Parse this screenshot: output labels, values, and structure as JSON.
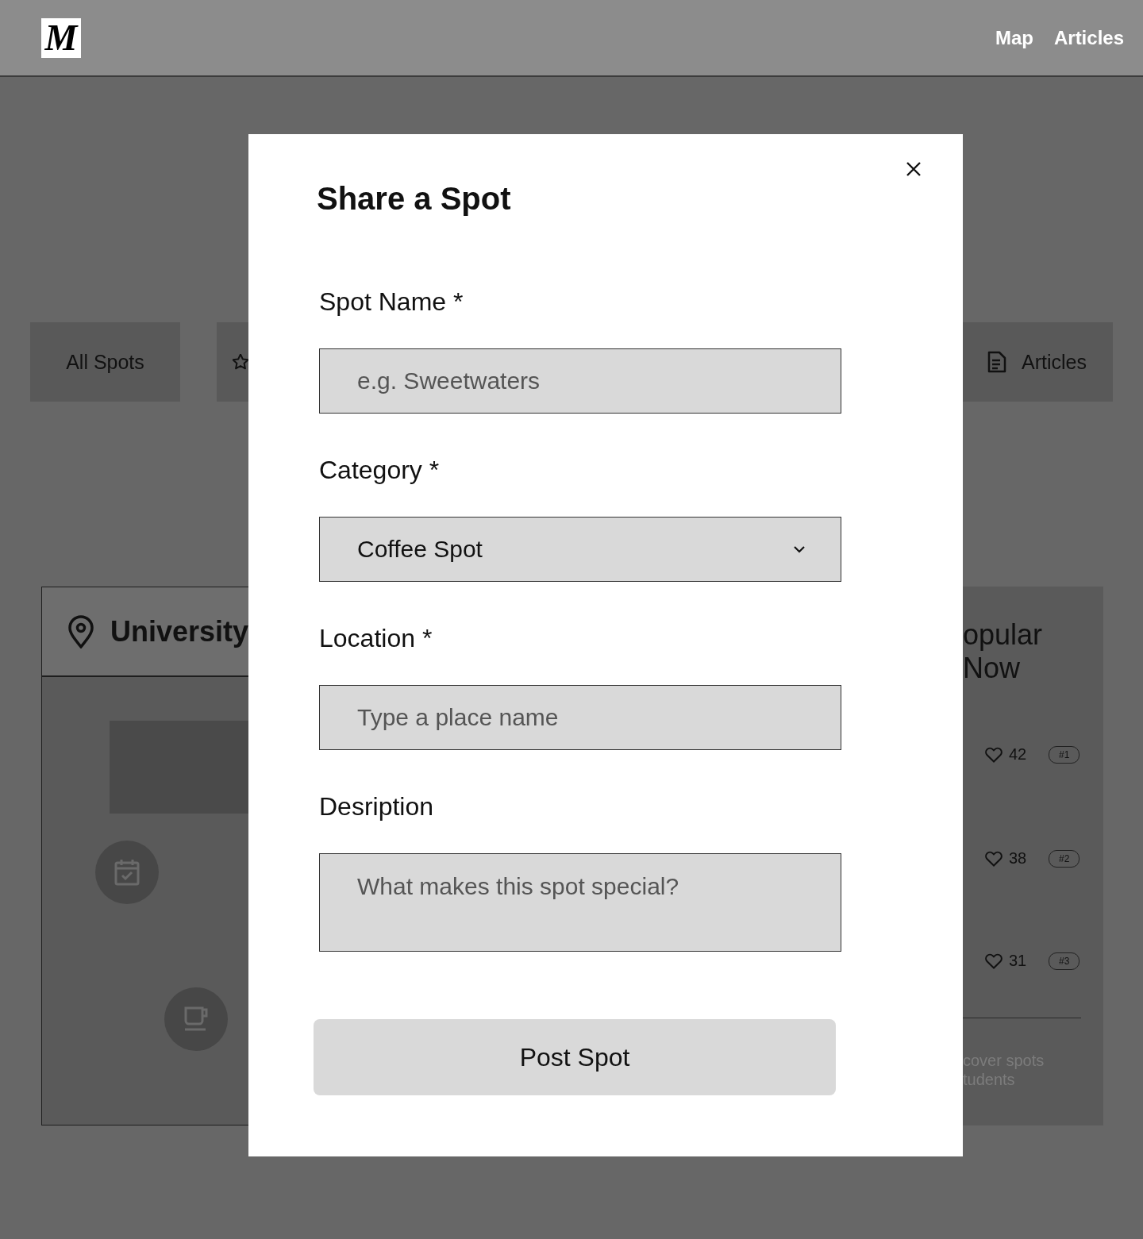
{
  "header": {
    "logo": "M",
    "nav": [
      {
        "label": "Map"
      },
      {
        "label": "Articles"
      }
    ]
  },
  "filter_tabs": [
    {
      "label": "All Spots"
    },
    {
      "label": "Articles"
    }
  ],
  "spot_card": {
    "title": "University"
  },
  "popular": {
    "title_lines": [
      "opular",
      "Now"
    ],
    "items": [
      {
        "likes": "42",
        "rank": "#1"
      },
      {
        "likes": "38",
        "rank": "#2"
      },
      {
        "likes": "31",
        "rank": "#3"
      }
    ],
    "footer_lines": [
      "cover spots",
      "tudents"
    ]
  },
  "modal": {
    "title": "Share a Spot",
    "fields": [
      {
        "kind": "text",
        "label": "Spot Name *",
        "placeholder": "e.g. Sweetwaters"
      },
      {
        "kind": "select",
        "label": "Category *",
        "value": "Coffee Spot"
      },
      {
        "kind": "text",
        "label": "Location *",
        "placeholder": "Type a place name"
      },
      {
        "kind": "textarea",
        "label": "Desription",
        "placeholder": "What makes this spot special?"
      }
    ],
    "submit": "Post Spot"
  }
}
